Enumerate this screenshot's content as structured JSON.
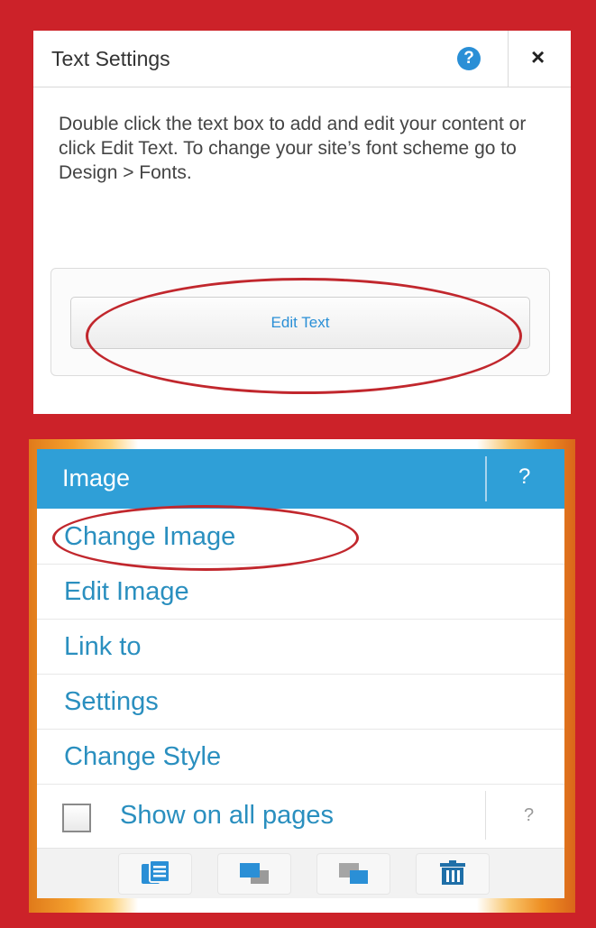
{
  "text_settings": {
    "title": "Text Settings",
    "help_label": "?",
    "close_label": "×",
    "description": "Double click the text box to add and edit your content or click Edit Text. To change your site’s font scheme go to Design > Fonts.",
    "edit_button": "Edit Text"
  },
  "image_menu": {
    "title": "Image",
    "help_label": "?",
    "items": [
      {
        "label": "Change Image"
      },
      {
        "label": "Edit Image"
      },
      {
        "label": "Link to"
      },
      {
        "label": "Settings"
      },
      {
        "label": "Change Style"
      }
    ],
    "show_all": {
      "label": "Show on all pages",
      "checked": false,
      "help_label": "?"
    },
    "toolbar": [
      "copy-icon",
      "bring-forward-icon",
      "send-backward-icon",
      "trash-icon"
    ]
  },
  "colors": {
    "frame_red": "#cc2229",
    "accent_blue": "#2f9fd7",
    "link_blue": "#2a8fbf",
    "annotation_red": "#c1272d"
  }
}
